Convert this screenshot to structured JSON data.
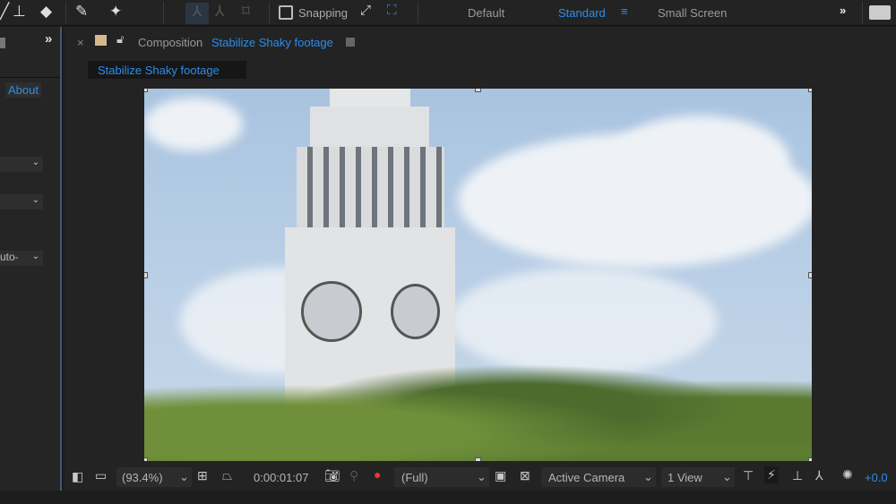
{
  "toolbar": {
    "snapping_label": "Snapping",
    "workspaces": [
      "Default",
      "Standard",
      "Small Screen"
    ],
    "active_workspace": "Standard"
  },
  "left_panel": {
    "about_label": "About",
    "dropdown_partial": "uto-"
  },
  "composition": {
    "panel_prefix": "Composition",
    "name": "Stabilize Shaky footage",
    "tab_label": "Stabilize Shaky footage"
  },
  "bottom_bar": {
    "zoom": "(93.4%)",
    "timecode": "0:00:01:07",
    "resolution": "(Full)",
    "camera": "Active Camera",
    "views": "1 View",
    "exposure": "+0.0"
  },
  "colors": {
    "accent": "#2d8ceb",
    "bg": "#232323"
  }
}
